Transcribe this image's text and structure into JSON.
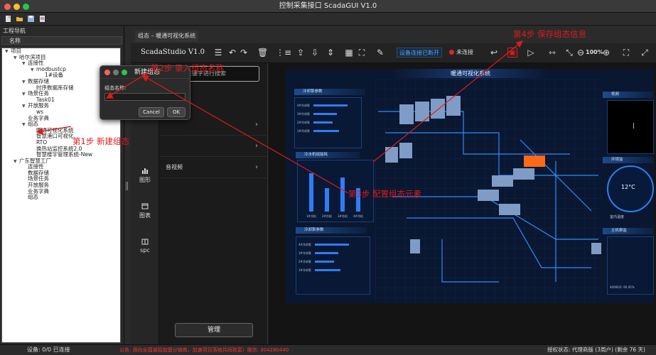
{
  "window": {
    "title": "控制采集接口 ScadaGUI V1.0"
  },
  "left_pane": {
    "title": "工程导航",
    "column_header": "名称",
    "tree": [
      {
        "label": "项目",
        "indent": 0,
        "arrow": "▼"
      },
      {
        "label": "哈尔滨项目",
        "indent": 1,
        "arrow": "▼"
      },
      {
        "label": "连接性",
        "indent": 2,
        "arrow": "▼"
      },
      {
        "label": "modbustcp",
        "indent": 3,
        "arrow": "▼"
      },
      {
        "label": "1#设备",
        "indent": 4,
        "arrow": ""
      },
      {
        "label": "数据存储",
        "indent": 2,
        "arrow": "▼"
      },
      {
        "label": "时序数据库存储",
        "indent": 3,
        "arrow": ""
      },
      {
        "label": "场景任务",
        "indent": 2,
        "arrow": "▼"
      },
      {
        "label": "Task01",
        "indent": 3,
        "arrow": ""
      },
      {
        "label": "开放服务",
        "indent": 2,
        "arrow": "▼"
      },
      {
        "label": "ws",
        "indent": 3,
        "arrow": ""
      },
      {
        "label": "业务字典",
        "indent": 2,
        "arrow": ""
      },
      {
        "label": "组态",
        "indent": 2,
        "arrow": "▼"
      },
      {
        "label": "暖通可视化系统",
        "indent": 3,
        "arrow": ""
      },
      {
        "label": "智慧港口可视化",
        "indent": 3,
        "arrow": ""
      },
      {
        "label": "RTO",
        "indent": 3,
        "arrow": ""
      },
      {
        "label": "换热站监控系统2.0",
        "indent": 3,
        "arrow": ""
      },
      {
        "label": "智慧楼宇管理系统-New",
        "indent": 3,
        "arrow": ""
      },
      {
        "label": "广东智慧工厂",
        "indent": 1,
        "arrow": "▼"
      },
      {
        "label": "连接性",
        "indent": 2,
        "arrow": ""
      },
      {
        "label": "数据存储",
        "indent": 2,
        "arrow": ""
      },
      {
        "label": "场景任务",
        "indent": 2,
        "arrow": ""
      },
      {
        "label": "开放服务",
        "indent": 2,
        "arrow": ""
      },
      {
        "label": "业务字典",
        "indent": 2,
        "arrow": ""
      },
      {
        "label": "组态",
        "indent": 2,
        "arrow": ""
      }
    ]
  },
  "tab": {
    "label": "组态 – 暖通可视化系统"
  },
  "toolbar": {
    "brand": "ScadaStudio",
    "version": "V1.0",
    "connection_badge": "设备连接已断开",
    "disconnected_label": "未连接",
    "zoom": "100%"
  },
  "sidebar": [
    {
      "label": "图形",
      "icon": "bar-chart-icon"
    },
    {
      "label": "图表",
      "icon": "calendar-icon"
    },
    {
      "label": "spc",
      "icon": "box-icon"
    }
  ],
  "panel": {
    "search_placeholder": "关键字进行搜索",
    "items": [
      "",
      "",
      "音视频"
    ],
    "manage_button": "管理"
  },
  "viz": {
    "title": "暖通可视化系统",
    "panels": [
      "冷却泵参数",
      "冷水机组能耗",
      "冷却泵参数",
      "视频",
      "环境监",
      "室内温度",
      "主机群监"
    ],
    "temperature": "12°C",
    "pump_rows": [
      "4#冷却泵",
      "3#冷却泵",
      "2#冷却泵",
      "1#冷却泵"
    ],
    "bar_labels": [
      "1#冷机",
      "2#冷机",
      "3#冷机",
      "4#冷机"
    ],
    "bar_values": [
      0.9,
      0.55,
      0.8,
      0.55
    ],
    "pump_values": [
      0.8,
      0.55,
      0.45,
      0.6,
      0.3,
      0.7
    ],
    "stat_value": "40000/2: 60.45%"
  },
  "dialog": {
    "title": "新建组态",
    "field_label": "组态名称:",
    "cancel": "Cancel",
    "ok": "OK"
  },
  "annotations": {
    "step1": "第1步 新建组态",
    "step2": "第2步 录入组态名称",
    "step3": "第3步 配置组态元素",
    "step4": "第4步 保存组态信息"
  },
  "statusbar": {
    "devices": "设备: 0/0 已连接",
    "notice": "公告: 面向全国诚招加盟分销商，加速项目落地共同致富）微信: 304280440",
    "license": "授权状态: 代理商版 (3周户) (剩余 76 天)"
  },
  "colors": {
    "accent_red": "#e01b1b",
    "link_blue": "#4da3ff",
    "viz_bg": "#0a1730"
  }
}
